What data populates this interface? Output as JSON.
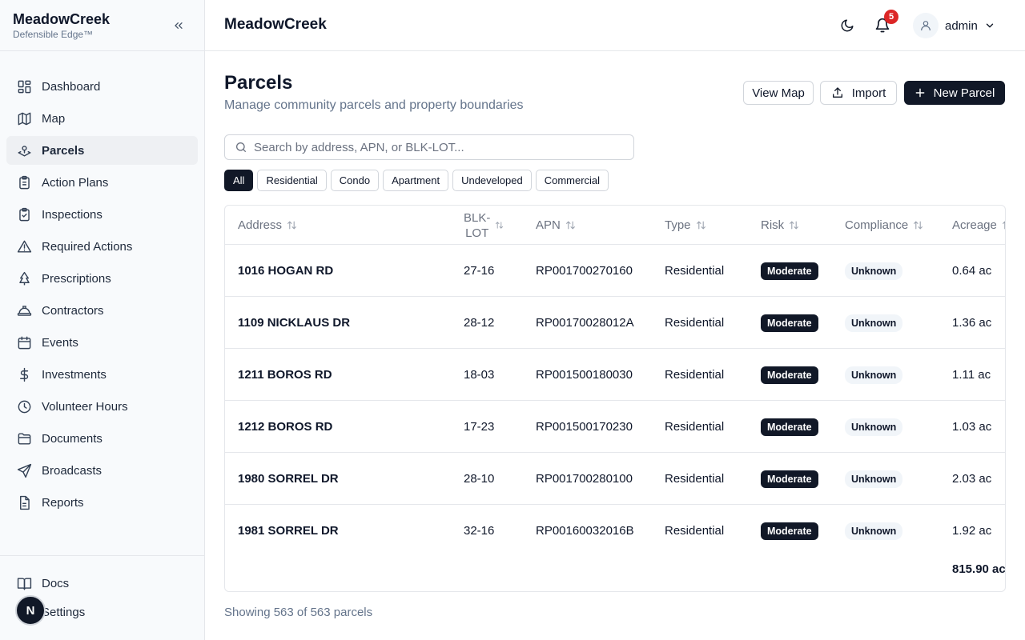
{
  "brand": {
    "name": "MeadowCreek",
    "tagline": "Defensible Edge™"
  },
  "sidebar": {
    "items": [
      {
        "label": "Dashboard",
        "icon": "dashboard-icon",
        "active": false
      },
      {
        "label": "Map",
        "icon": "map-icon",
        "active": false
      },
      {
        "label": "Parcels",
        "icon": "parcels-icon",
        "active": true
      },
      {
        "label": "Action Plans",
        "icon": "clipboard-icon",
        "active": false
      },
      {
        "label": "Inspections",
        "icon": "clipboard-check-icon",
        "active": false
      },
      {
        "label": "Required Actions",
        "icon": "warning-triangle-icon",
        "active": false
      },
      {
        "label": "Prescriptions",
        "icon": "tree-icon",
        "active": false
      },
      {
        "label": "Contractors",
        "icon": "hardhat-icon",
        "active": false
      },
      {
        "label": "Events",
        "icon": "calendar-icon",
        "active": false
      },
      {
        "label": "Investments",
        "icon": "dollar-icon",
        "active": false
      },
      {
        "label": "Volunteer Hours",
        "icon": "clock-icon",
        "active": false
      },
      {
        "label": "Documents",
        "icon": "folder-icon",
        "active": false
      },
      {
        "label": "Broadcasts",
        "icon": "send-icon",
        "active": false
      },
      {
        "label": "Reports",
        "icon": "report-icon",
        "active": false
      }
    ],
    "bottom": [
      {
        "label": "Docs",
        "icon": "book-icon"
      },
      {
        "label": "Settings",
        "icon": "gear-icon"
      }
    ],
    "fab_label": "N"
  },
  "header": {
    "title": "MeadowCreek",
    "notifications": "5",
    "user": "admin"
  },
  "page": {
    "title": "Parcels",
    "subtitle": "Manage community parcels and property boundaries",
    "view_map": "View Map",
    "import": "Import",
    "new_parcel": "New Parcel"
  },
  "search": {
    "placeholder": "Search by address, APN, or BLK-LOT..."
  },
  "filters": [
    "All",
    "Residential",
    "Condo",
    "Apartment",
    "Undeveloped",
    "Commercial"
  ],
  "active_filter": "All",
  "table": {
    "columns": {
      "address": "Address",
      "blk_line1": "BLK-",
      "blk_line2": "LOT",
      "apn": "APN",
      "type": "Type",
      "risk": "Risk",
      "compliance": "Compliance",
      "acreage": "Acreage"
    },
    "rows": [
      {
        "address": "1016 HOGAN RD",
        "blk": "27-16",
        "apn": "RP001700270160",
        "type": "Residential",
        "risk": "Moderate",
        "compliance": "Unknown",
        "acreage": "0.64 ac"
      },
      {
        "address": "1109 NICKLAUS DR",
        "blk": "28-12",
        "apn": "RP00170028012A",
        "type": "Residential",
        "risk": "Moderate",
        "compliance": "Unknown",
        "acreage": "1.36 ac"
      },
      {
        "address": "1211 BOROS RD",
        "blk": "18-03",
        "apn": "RP001500180030",
        "type": "Residential",
        "risk": "Moderate",
        "compliance": "Unknown",
        "acreage": "1.11 ac"
      },
      {
        "address": "1212 BOROS RD",
        "blk": "17-23",
        "apn": "RP001500170230",
        "type": "Residential",
        "risk": "Moderate",
        "compliance": "Unknown",
        "acreage": "1.03 ac"
      },
      {
        "address": "1980 SORREL DR",
        "blk": "28-10",
        "apn": "RP001700280100",
        "type": "Residential",
        "risk": "Moderate",
        "compliance": "Unknown",
        "acreage": "2.03 ac"
      },
      {
        "address": "1981 SORREL DR",
        "blk": "32-16",
        "apn": "RP00160032016B",
        "type": "Residential",
        "risk": "Moderate",
        "compliance": "Unknown",
        "acreage": "1.92 ac"
      }
    ],
    "total_acreage": "815.90 ac"
  },
  "footer": {
    "count_text": "Showing 563 of 563 parcels"
  }
}
